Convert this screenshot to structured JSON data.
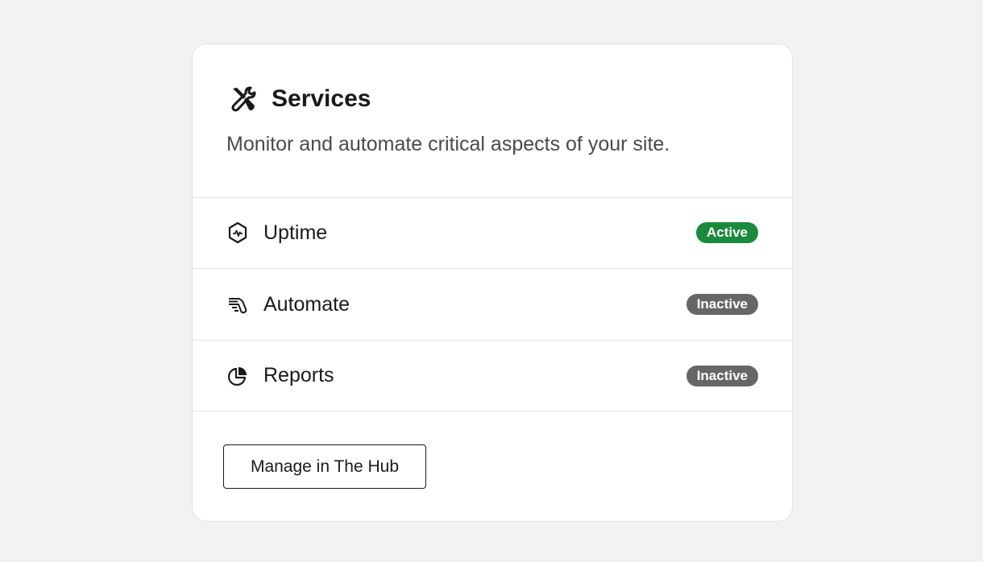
{
  "card": {
    "title": "Services",
    "title_icon": "tools-icon",
    "subtitle": "Monitor and automate critical aspects of your site."
  },
  "services": [
    {
      "label": "Uptime",
      "icon": "uptime-hexagon-icon",
      "status": "Active",
      "status_color": "#1a8a3c"
    },
    {
      "label": "Automate",
      "icon": "automate-icon",
      "status": "Inactive",
      "status_color": "#666666"
    },
    {
      "label": "Reports",
      "icon": "pie-chart-icon",
      "status": "Inactive",
      "status_color": "#666666"
    }
  ],
  "footer": {
    "button_label": "Manage in The Hub"
  }
}
